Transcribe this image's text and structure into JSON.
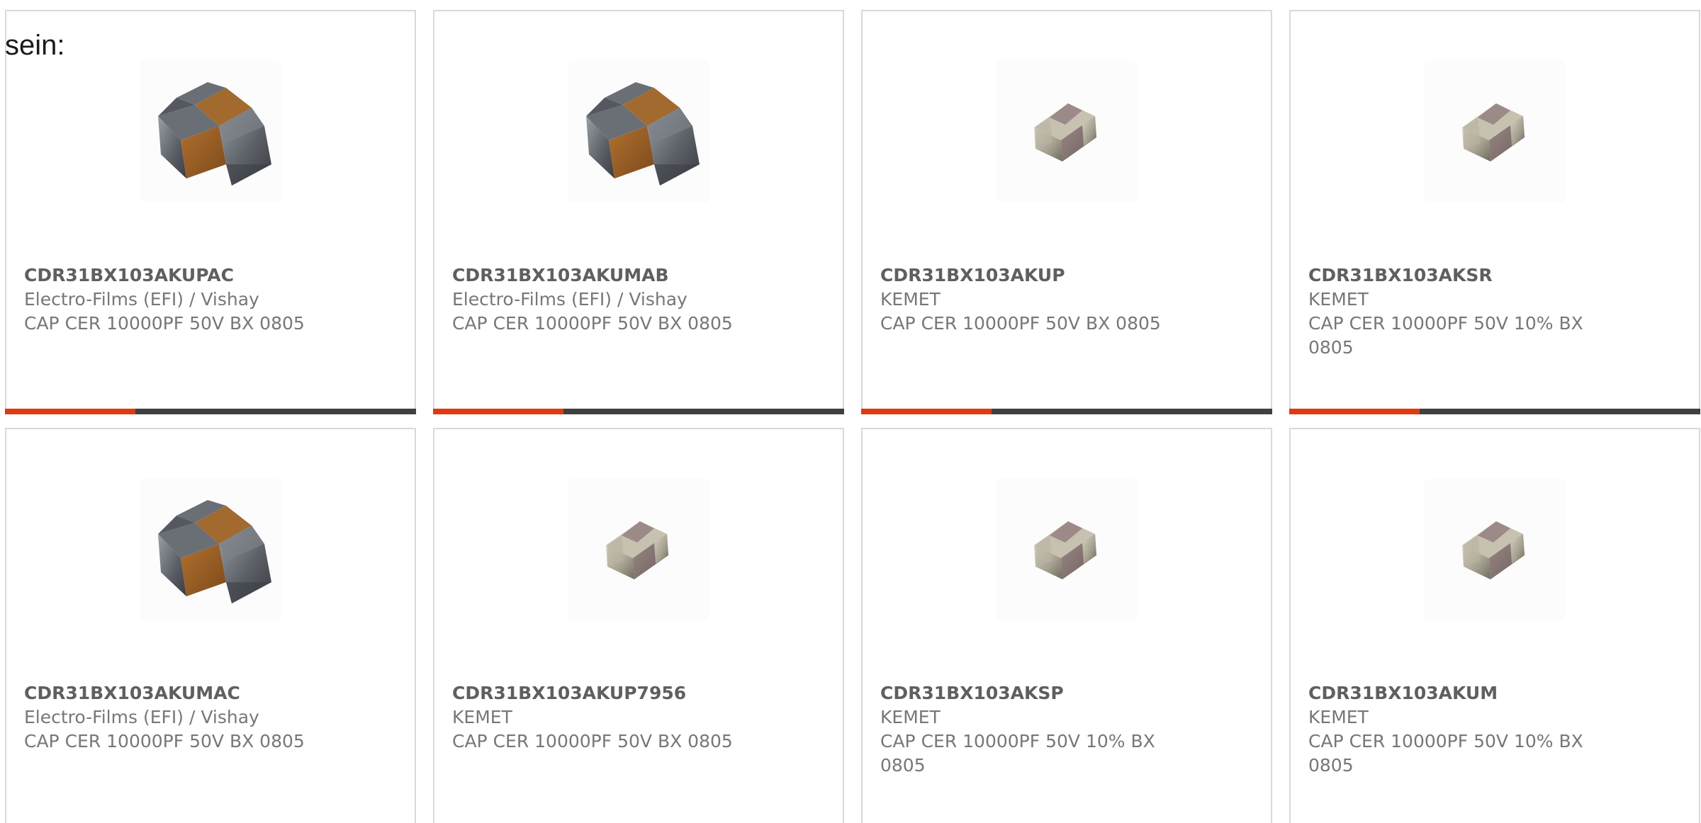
{
  "page": {
    "lead_text": "sein:"
  },
  "products": [
    {
      "part_number": "CDR31BX103AKUPAC",
      "manufacturer": "Electro-Films (EFI) / Vishay",
      "description": "CAP CER 10000PF 50V BX 0805",
      "image": "large-ceramic-chip-capacitor-icon"
    },
    {
      "part_number": "CDR31BX103AKUMAB",
      "manufacturer": "Electro-Films (EFI) / Vishay",
      "description": "CAP CER 10000PF 50V BX 0805",
      "image": "large-ceramic-chip-capacitor-icon"
    },
    {
      "part_number": "CDR31BX103AKUP",
      "manufacturer": "KEMET",
      "description": "CAP CER 10000PF 50V BX 0805",
      "image": "small-ceramic-chip-capacitor-icon"
    },
    {
      "part_number": "CDR31BX103AKSR",
      "manufacturer": "KEMET",
      "description": "CAP CER 10000PF 50V 10% BX 0805",
      "image": "small-ceramic-chip-capacitor-icon"
    },
    {
      "part_number": "CDR31BX103AKUMAC",
      "manufacturer": "Electro-Films (EFI) / Vishay",
      "description": "CAP CER 10000PF 50V BX 0805",
      "image": "large-ceramic-chip-capacitor-icon"
    },
    {
      "part_number": "CDR31BX103AKUP7956",
      "manufacturer": "KEMET",
      "description": "CAP CER 10000PF 50V BX 0805",
      "image": "small-ceramic-chip-capacitor-icon"
    },
    {
      "part_number": "CDR31BX103AKSP",
      "manufacturer": "KEMET",
      "description": "CAP CER 10000PF 50V 10% BX 0805",
      "image": "small-ceramic-chip-capacitor-icon"
    },
    {
      "part_number": "CDR31BX103AKUM",
      "manufacturer": "KEMET",
      "description": "CAP CER 10000PF 50V 10% BX 0805",
      "image": "small-ceramic-chip-capacitor-icon"
    }
  ],
  "colors": {
    "accent": "#e03a12",
    "bar": "#404040",
    "card_border": "#d9d9d9",
    "part_number_text": "#5f5f5f",
    "secondary_text": "#777777"
  }
}
